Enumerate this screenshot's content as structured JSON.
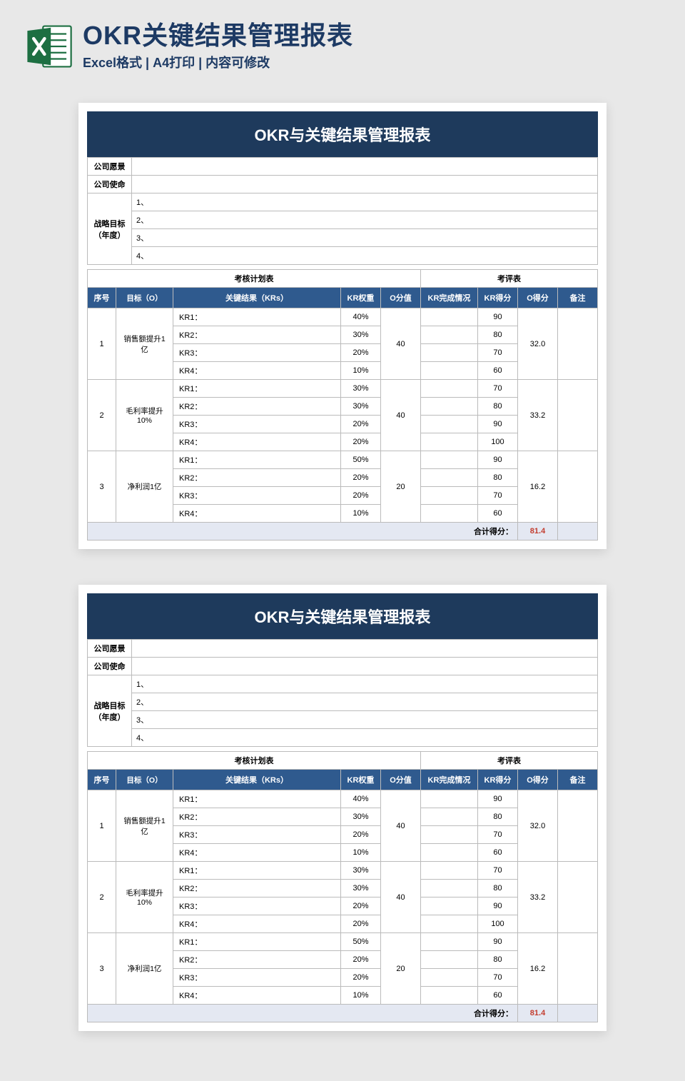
{
  "header": {
    "title": "OKR关键结果管理报表",
    "subtitle": "Excel格式 | A4打印 | 内容可修改"
  },
  "sheet": {
    "title": "OKR与关键结果管理报表",
    "info": {
      "vision_label": "公司愿景",
      "mission_label": "公司使命",
      "goals_label": "战略目标\n（年度）",
      "goal_nums": [
        "1、",
        "2、",
        "3、",
        "4、"
      ]
    },
    "sections": {
      "plan": "考核计划表",
      "review": "考评表"
    },
    "cols": {
      "seq": "序号",
      "obj": "目标（O）",
      "kr": "关键结果（KRs）",
      "weight": "KR权重",
      "ovalue": "O分值",
      "done": "KR完成情况",
      "krscore": "KR得分",
      "oscore": "O得分",
      "note": "备注"
    },
    "rows": [
      {
        "seq": "1",
        "obj": "销售额提升1亿",
        "ovalue": "40",
        "oscore": "32.0",
        "krs": [
          {
            "kr": "KR1：",
            "w": "40%",
            "s": "90"
          },
          {
            "kr": "KR2：",
            "w": "30%",
            "s": "80"
          },
          {
            "kr": "KR3：",
            "w": "20%",
            "s": "70"
          },
          {
            "kr": "KR4：",
            "w": "10%",
            "s": "60"
          }
        ]
      },
      {
        "seq": "2",
        "obj": "毛利率提升10%",
        "ovalue": "40",
        "oscore": "33.2",
        "krs": [
          {
            "kr": "KR1：",
            "w": "30%",
            "s": "70"
          },
          {
            "kr": "KR2：",
            "w": "30%",
            "s": "80"
          },
          {
            "kr": "KR3：",
            "w": "20%",
            "s": "90"
          },
          {
            "kr": "KR4：",
            "w": "20%",
            "s": "100"
          }
        ]
      },
      {
        "seq": "3",
        "obj": "净利润1亿",
        "ovalue": "20",
        "oscore": "16.2",
        "krs": [
          {
            "kr": "KR1：",
            "w": "50%",
            "s": "90"
          },
          {
            "kr": "KR2：",
            "w": "20%",
            "s": "80"
          },
          {
            "kr": "KR3：",
            "w": "20%",
            "s": "70"
          },
          {
            "kr": "KR4：",
            "w": "10%",
            "s": "60"
          }
        ]
      }
    ],
    "total": {
      "label": "合计得分：",
      "value": "81.4"
    }
  }
}
